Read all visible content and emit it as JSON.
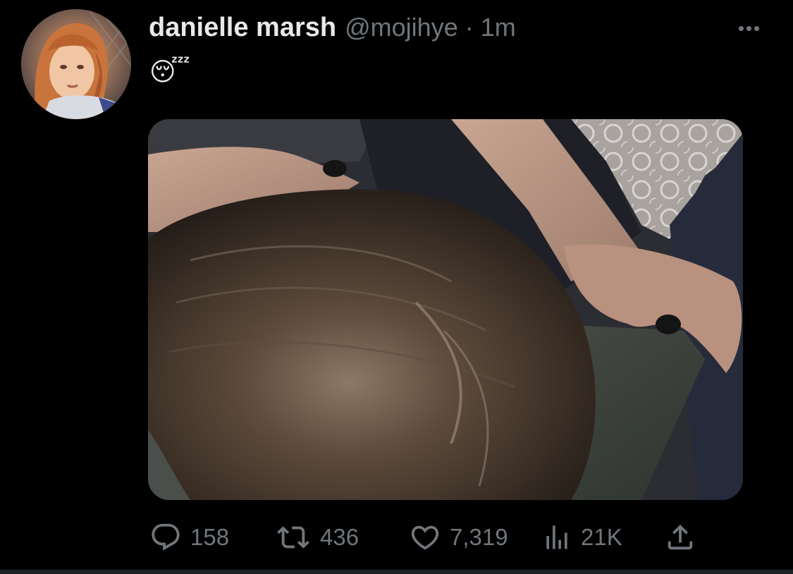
{
  "tweet": {
    "author": {
      "display_name": "danielle marsh",
      "handle": "@mojihye",
      "avatar_icon": "profile-photo"
    },
    "separator": "·",
    "time": "1m",
    "text": "😴",
    "more_icon": "more-horizontal-icon",
    "media": {
      "kind": "photo"
    },
    "actions": {
      "reply": {
        "icon": "reply-icon",
        "count": "158"
      },
      "retweet": {
        "icon": "retweet-icon",
        "count": "436"
      },
      "like": {
        "icon": "heart-icon",
        "count": "7,319"
      },
      "views": {
        "icon": "views-icon",
        "count": "21K"
      },
      "share": {
        "icon": "share-icon"
      }
    }
  },
  "colors": {
    "background": "#000000",
    "primary_text": "#e7e9ea",
    "secondary_text": "#71767b",
    "divider": "#1e2124"
  }
}
